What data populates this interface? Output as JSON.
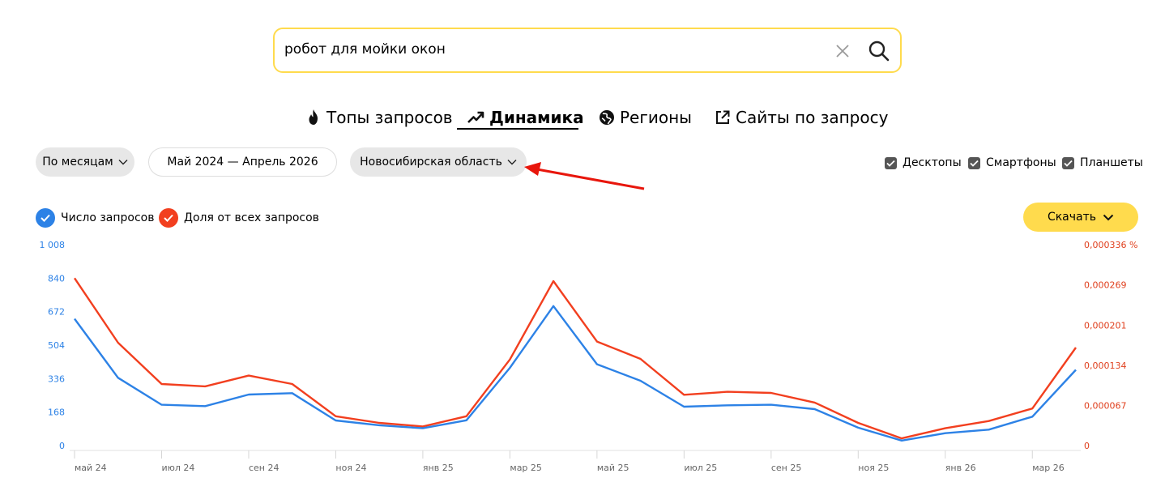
{
  "search": {
    "value": "робот для мойки окон"
  },
  "tabs": [
    {
      "label": "Топы запросов",
      "icon": "fire-icon",
      "active": false
    },
    {
      "label": "Динамика",
      "icon": "trend-icon",
      "active": true
    },
    {
      "label": "Регионы",
      "icon": "globe-icon",
      "active": false
    },
    {
      "label": "Сайты по запросу",
      "icon": "external-link-icon",
      "active": false
    }
  ],
  "filters": {
    "period_grouping": "По месяцам",
    "date_range": "Май 2024 — Апрель 2026",
    "region": "Новосибирская область"
  },
  "devices": [
    {
      "label": "Десктопы",
      "checked": true
    },
    {
      "label": "Смартфоны",
      "checked": true
    },
    {
      "label": "Планшеты",
      "checked": true
    }
  ],
  "legend": [
    {
      "label": "Число запросов",
      "color": "#2d82e6",
      "checked": true
    },
    {
      "label": "Доля от всех запросов",
      "color": "#f23f1f",
      "checked": true
    }
  ],
  "download": {
    "label": "Скачать"
  },
  "colors": {
    "accent_yellow": "#ffdb4d",
    "series_blue": "#2d82e6",
    "series_red": "#f23f1f",
    "annotation_arrow": "#e8160c"
  },
  "chart_data": {
    "type": "line",
    "x": [
      "май 24",
      "июн 24",
      "июл 24",
      "авг 24",
      "сен 24",
      "окт 24",
      "ноя 24",
      "дек 24",
      "янв 25",
      "фев 25",
      "мар 25",
      "апр 25",
      "май 25",
      "июн 25",
      "июл 25",
      "авг 25",
      "сен 25",
      "окт 25",
      "ноя 25",
      "дек 25",
      "янв 26",
      "фев 26",
      "мар 26",
      "апр 26"
    ],
    "x_tick_labels": [
      "май 24",
      "июл 24",
      "сен 24",
      "ноя 24",
      "янв 25",
      "мар 25",
      "май 25",
      "июл 25",
      "сен 25",
      "ноя 25",
      "янв 26",
      "мар 26"
    ],
    "series": [
      {
        "name": "Число запросов",
        "axis": "left",
        "color": "#2d82e6",
        "values": [
          636,
          340,
          205,
          198,
          256,
          263,
          126,
          102,
          87,
          127,
          390,
          700,
          408,
          325,
          195,
          202,
          205,
          183,
          90,
          25,
          62,
          80,
          145,
          380
        ]
      },
      {
        "name": "Доля от всех запросов",
        "axis": "right",
        "color": "#f23f1f",
        "values": [
          0.00028,
          0.000172,
          0.000103,
          9.9e-05,
          0.000117,
          0.000103,
          4.9e-05,
          3.8e-05,
          3.2e-05,
          4.9e-05,
          0.000144,
          0.000275,
          0.000174,
          0.000145,
          8.5e-05,
          9e-05,
          8.8e-05,
          7.2e-05,
          3.8e-05,
          1.2e-05,
          2.9e-05,
          4.1e-05,
          6.2e-05,
          0.000164
        ]
      }
    ],
    "y_left": {
      "ticks": [
        0,
        168,
        336,
        504,
        672,
        840,
        1008
      ],
      "tick_labels": [
        "0",
        "168",
        "336",
        "504",
        "672",
        "840",
        "1 008"
      ],
      "ylim": [
        0,
        1008
      ]
    },
    "y_right": {
      "ticks": [
        0,
        6.7e-05,
        0.000134,
        0.000201,
        0.000269,
        0.000336
      ],
      "tick_labels": [
        "0",
        "0,000067",
        "0,000134",
        "0,000201",
        "0,000269",
        "0,000336 %"
      ],
      "ylim": [
        0,
        0.000336
      ]
    },
    "grid": false
  }
}
